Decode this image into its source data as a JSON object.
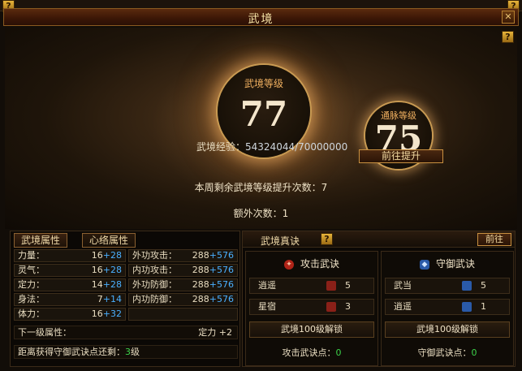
{
  "window": {
    "title": "武境"
  },
  "hero": {
    "realm_label": "武境等级",
    "realm_level": "77",
    "meridian_label": "通脉等级",
    "meridian_level": "75",
    "exp_label": "武境经验：",
    "exp_value": "54324044/70000000",
    "goto_upgrade": "前往提升",
    "weekly_text": "本周剩余武境等级提升次数：7",
    "extra_text": "额外次数：1"
  },
  "left": {
    "tabs": [
      "武境属性",
      "心络属性"
    ],
    "stats": [
      {
        "label": "力量：",
        "base": "16",
        "bonus": "+28"
      },
      {
        "label": "灵气：",
        "base": "16",
        "bonus": "+28"
      },
      {
        "label": "定力：",
        "base": "14",
        "bonus": "+28"
      },
      {
        "label": "身法：",
        "base": "7",
        "bonus": "+14"
      },
      {
        "label": "体力：",
        "base": "16",
        "bonus": "+32"
      }
    ],
    "combat": [
      {
        "label": "外功攻击：",
        "base": "288",
        "bonus": "+576"
      },
      {
        "label": "内功攻击：",
        "base": "288",
        "bonus": "+576"
      },
      {
        "label": "外功防御：",
        "base": "288",
        "bonus": "+576"
      },
      {
        "label": "内功防御：",
        "base": "288",
        "bonus": "+576"
      }
    ],
    "next_label": "下一级属性：",
    "next_value": "定力 +2",
    "distance_label": "距离获得守御武诀点还剩：",
    "distance_value": "3",
    "distance_unit": "级"
  },
  "right": {
    "title": "武境真诀",
    "goto": "前往",
    "attack": {
      "header": "攻击武诀",
      "rows": [
        {
          "name": "逍遥",
          "count": "5"
        },
        {
          "name": "星宿",
          "count": "3"
        }
      ],
      "unlock": "武境100级解锁",
      "points_label": "攻击武诀点：",
      "points": "0"
    },
    "defense": {
      "header": "守御武诀",
      "rows": [
        {
          "name": "武当",
          "count": "5"
        },
        {
          "name": "逍遥",
          "count": "1"
        }
      ],
      "unlock": "武境100级解锁",
      "points_label": "守御武诀点：",
      "points": "0"
    }
  },
  "colors": {
    "accent": "#f0b060",
    "bonus": "#4ab0ff",
    "points": "#3cd24a"
  }
}
